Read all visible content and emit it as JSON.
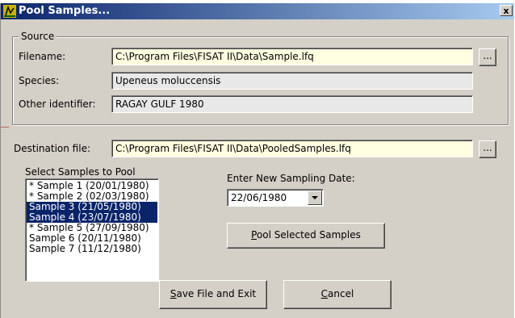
{
  "window": {
    "title": "Pool Samples...",
    "close_label": "x"
  },
  "source": {
    "legend": "Source",
    "filename_label": "Filename:",
    "filename_value": "C:\\Program Files\\FISAT II\\Data\\Sample.lfq",
    "species_label": "Species:",
    "species_value": "Upeneus moluccensis",
    "identifier_label": "Other identifier:",
    "identifier_value": "RAGAY GULF 1980",
    "browse_label": "..."
  },
  "destination": {
    "label": "Destination file:",
    "value": "C:\\Program Files\\FISAT II\\Data\\PooledSamples.lfq",
    "browse_label": "..."
  },
  "samples": {
    "label": "Select Samples to Pool",
    "items": [
      {
        "label": "* Sample 1 (20/01/1980)",
        "selected": false
      },
      {
        "label": "* Sample 2 (02/03/1980)",
        "selected": false
      },
      {
        "label": "Sample 3 (21/05/1980)",
        "selected": true
      },
      {
        "label": "Sample 4 (23/07/1980)",
        "selected": true
      },
      {
        "label": "* Sample 5 (27/09/1980)",
        "selected": false
      },
      {
        "label": "Sample 6 (20/11/1980)",
        "selected": false
      },
      {
        "label": "Sample 7 (11/12/1980)",
        "selected": false
      }
    ]
  },
  "date": {
    "label": "Enter New Sampling Date:",
    "value": "22/06/1980"
  },
  "buttons": {
    "pool_access": "P",
    "pool_rest": "ool Selected Samples",
    "save_access": "S",
    "save_rest": "ave File and Exit",
    "cancel_access": "C",
    "cancel_rest": "ancel"
  }
}
